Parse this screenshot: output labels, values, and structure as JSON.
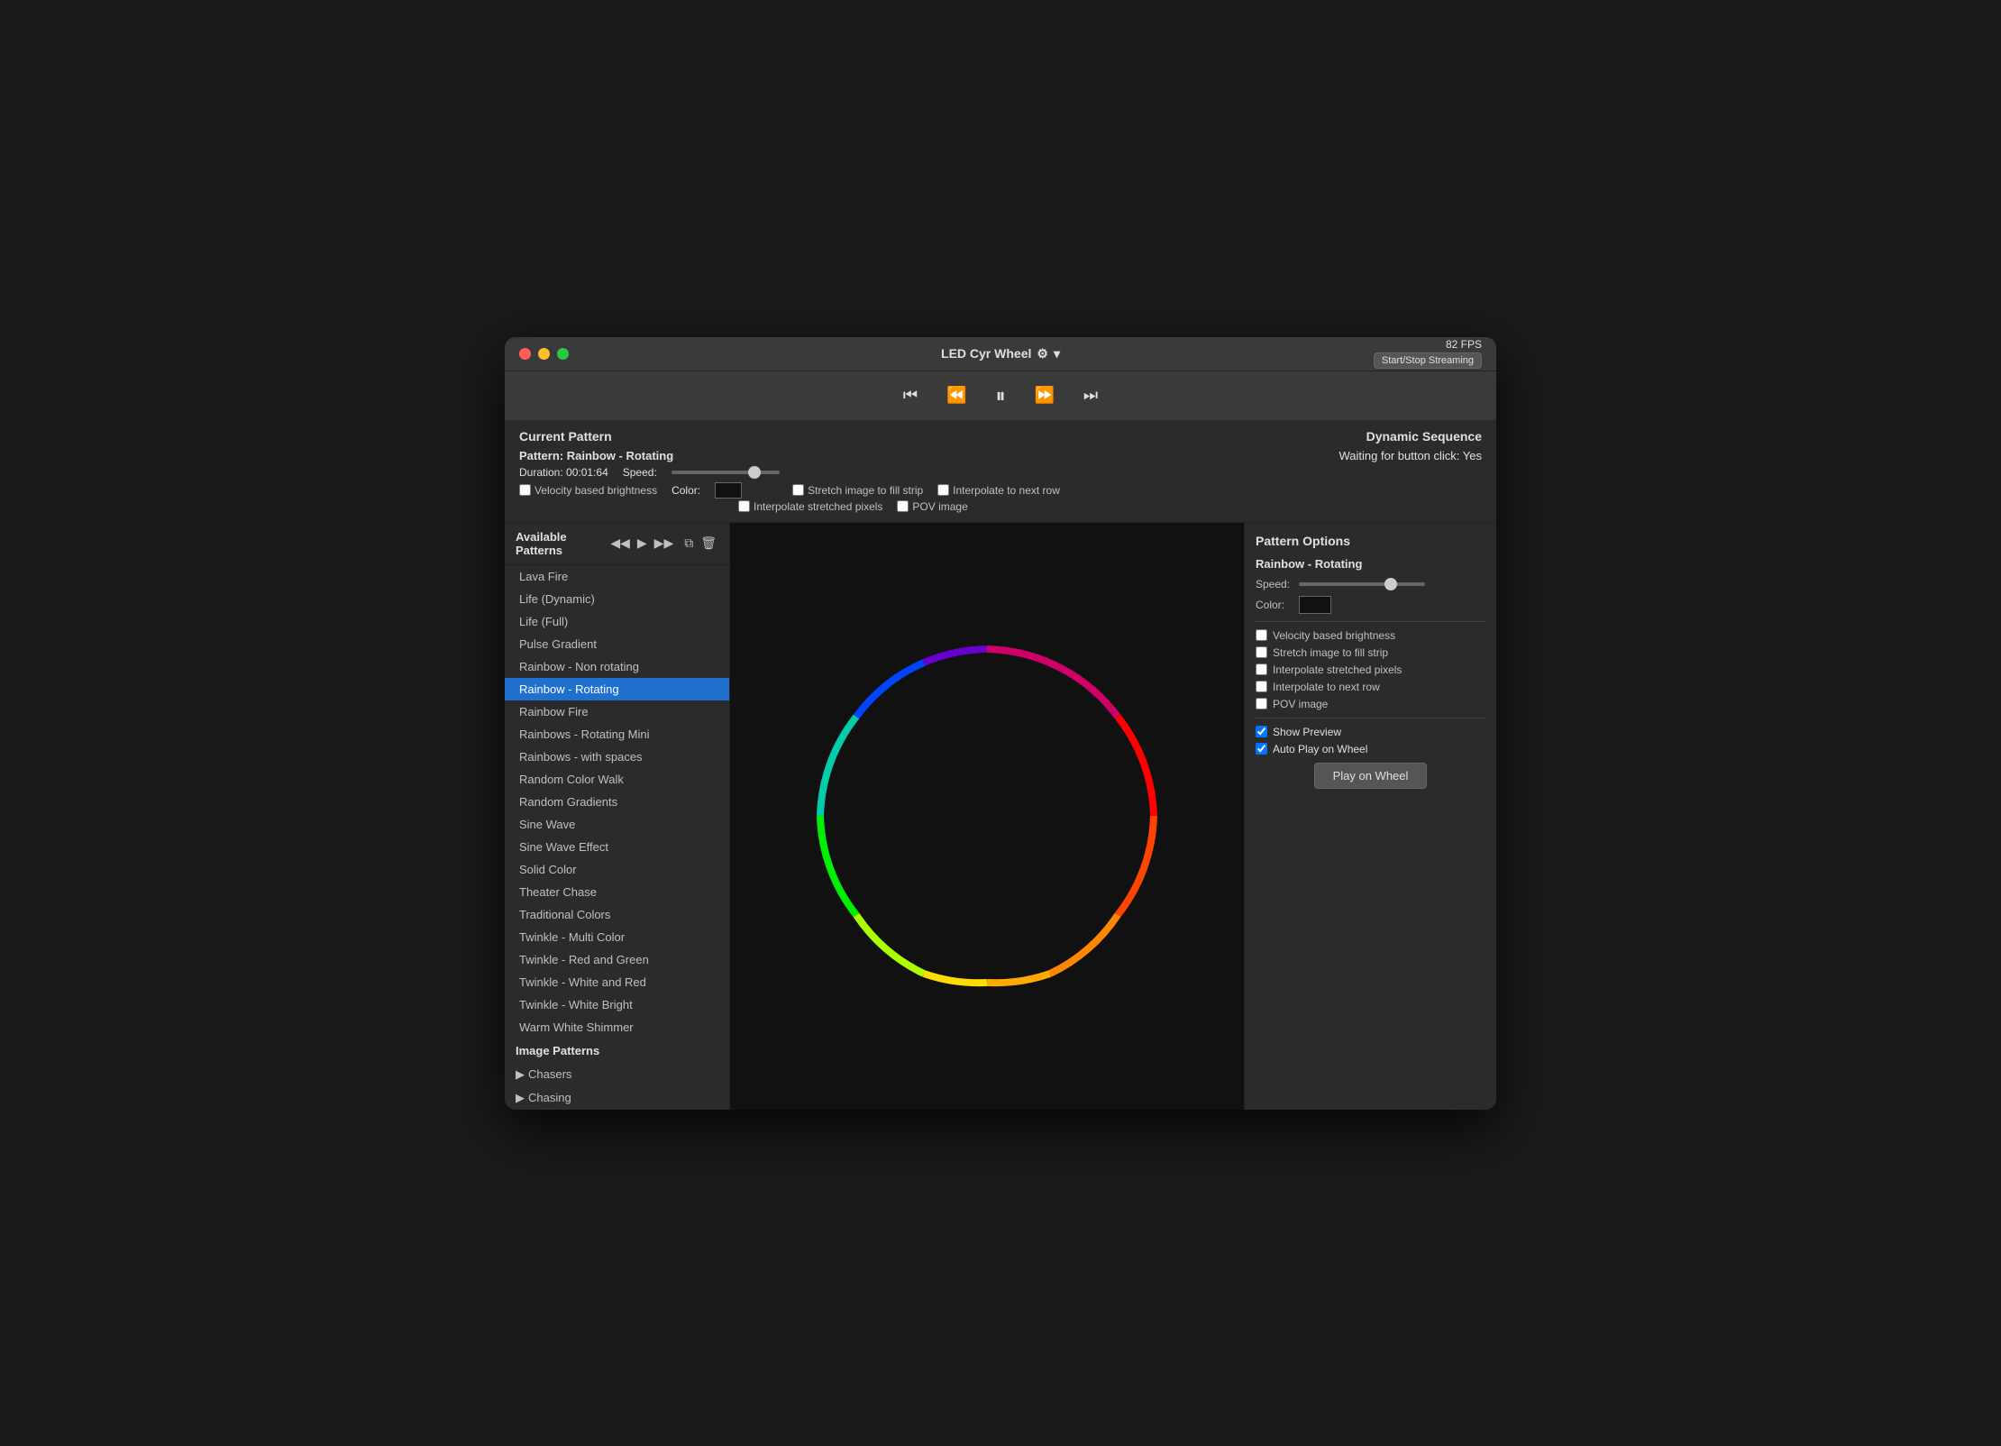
{
  "window": {
    "title": "LED Cyr Wheel",
    "fps": "82 FPS",
    "stream_btn": "Start/Stop Streaming"
  },
  "transport": {
    "skip_back": "⏮",
    "rewind": "⏪",
    "pause": "⏸",
    "forward": "⏩",
    "skip_forward": "⏭"
  },
  "current_pattern": {
    "section_label": "Current Pattern",
    "sequence_label": "Dynamic Sequence",
    "pattern_name": "Pattern: Rainbow - Rotating",
    "duration": "Duration:  00:01:64",
    "speed_label": "Speed:",
    "color_label": "Color:",
    "waiting_label": "Waiting for button click:  Yes",
    "velocity_label": "Velocity based brightness",
    "stretch_label": "Stretch image to fill strip",
    "interpolate_row_label": "Interpolate to next row",
    "interpolate_px_label": "Interpolate stretched pixels",
    "pov_label": "POV image"
  },
  "available_patterns": {
    "title": "Available Patterns",
    "items": [
      "Lava Fire",
      "Life (Dynamic)",
      "Life (Full)",
      "Pulse Gradient",
      "Rainbow - Non rotating",
      "Rainbow - Rotating",
      "Rainbow Fire",
      "Rainbows - Rotating Mini",
      "Rainbows - with spaces",
      "Random Color Walk",
      "Random Gradients",
      "Sine Wave",
      "Sine Wave Effect",
      "Solid Color",
      "Theater Chase",
      "Traditional Colors",
      "Twinkle - Multi Color",
      "Twinkle - Red and Green",
      "Twinkle - White and Red",
      "Twinkle - White Bright",
      "Warm White Shimmer"
    ],
    "selected_index": 5,
    "section_image": "Image Patterns",
    "chasers": "Chasers",
    "chasing": "Chasing"
  },
  "pattern_options": {
    "title": "Pattern Options",
    "pattern_name": "Rainbow - Rotating",
    "speed_label": "Speed:",
    "color_label": "Color:",
    "velocity_label": "Velocity based brightness",
    "velocity_checked": false,
    "stretch_label": "Stretch image to fill strip",
    "stretch_checked": false,
    "interpolate_px_label": "Interpolate stretched pixels",
    "interpolate_px_checked": false,
    "interpolate_row_label": "Interpolate to next row",
    "interpolate_row_checked": false,
    "pov_label": "POV image",
    "pov_checked": false,
    "show_preview_label": "Show Preview",
    "show_preview_checked": true,
    "auto_play_label": "Auto Play on Wheel",
    "auto_play_checked": true,
    "play_btn": "Play on Wheel"
  },
  "icons": {
    "gear": "⚙",
    "chevron_down": "▾",
    "copy": "⧉",
    "trash": "🗑",
    "triangle_right": "▶",
    "double_left": "◀◀",
    "play": "▶",
    "double_right": "▶▶"
  }
}
